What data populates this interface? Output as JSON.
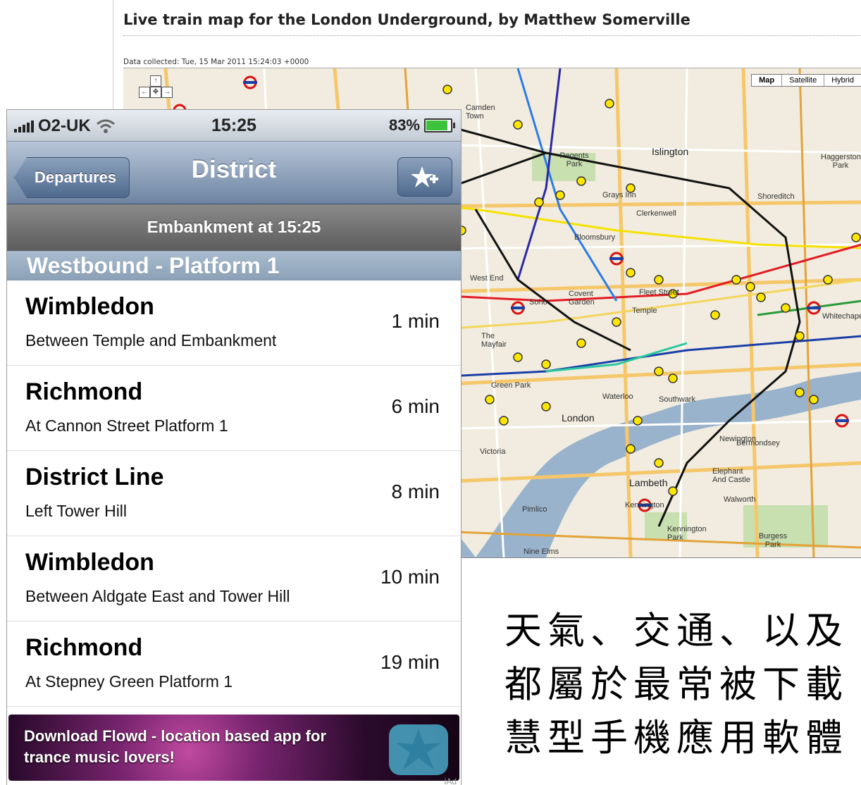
{
  "map_page": {
    "title": "Live train map for the London Underground, by Matthew Somerville",
    "collected": "Data collected: Tue, 15 Mar 2011 15:24:03 +0000",
    "map_types": [
      "Map",
      "Satellite",
      "Hybrid"
    ],
    "labels": {
      "camden_town": "Camden Town",
      "regents_park": "Regents Park",
      "islington": "Islington",
      "grays_inn": "Grays Inn",
      "clerkenwell": "Clerkenwell",
      "shoreditch": "Shoreditch",
      "haggerston_park": "Haggerston Park",
      "bloomsbury": "Bloomsbury",
      "west_end": "West End",
      "soho": "Soho",
      "covent_garden": "Covent Garden",
      "fleet_street": "Fleet Street",
      "temple": "Temple",
      "whitechapel": "Whitechapel",
      "mayfair": "The Mayfair",
      "green_park": "Green Park",
      "waterloo": "Waterloo",
      "southwark": "Southwark",
      "london": "London",
      "bermondsey": "Bermondsey",
      "newington": "Newington",
      "elephant_castle": "Elephant And Castle",
      "lambeth": "Lambeth",
      "victoria": "Victoria",
      "pimlico": "Pimlico",
      "kennington": "Kennington",
      "kennington_park": "Kennington Park",
      "walworth": "Walworth",
      "burgess_park": "Burgess Park",
      "nine_elms": "Nine Elms"
    }
  },
  "phone": {
    "status": {
      "carrier": "O2-UK",
      "time": "15:25",
      "battery": "83%",
      "battery_level": 0.83
    },
    "nav": {
      "back_label": "Departures",
      "title": "District"
    },
    "station_header": "Embankment at 15:25",
    "section_header": "Westbound - Platform 1",
    "departures": [
      {
        "destination": "Wimbledon",
        "location": "Between Temple and Embankment",
        "time": "1 min"
      },
      {
        "destination": "Richmond",
        "location": "At Cannon Street Platform 1",
        "time": "6 min"
      },
      {
        "destination": "District Line",
        "location": "Left Tower Hill",
        "time": "8 min"
      },
      {
        "destination": "Wimbledon",
        "location": "Between Aldgate East and Tower Hill",
        "time": "10 min"
      },
      {
        "destination": "Richmond",
        "location": "At Stepney Green Platform 1",
        "time": "19 min"
      }
    ],
    "ad": {
      "text": "Download Flowd - location based app for trance music lovers!",
      "badge": "iAd"
    }
  },
  "caption": {
    "line1": "天氣、交通、以及",
    "line2": "都屬於最常被下載",
    "line3": "慧型手機應用軟體"
  }
}
